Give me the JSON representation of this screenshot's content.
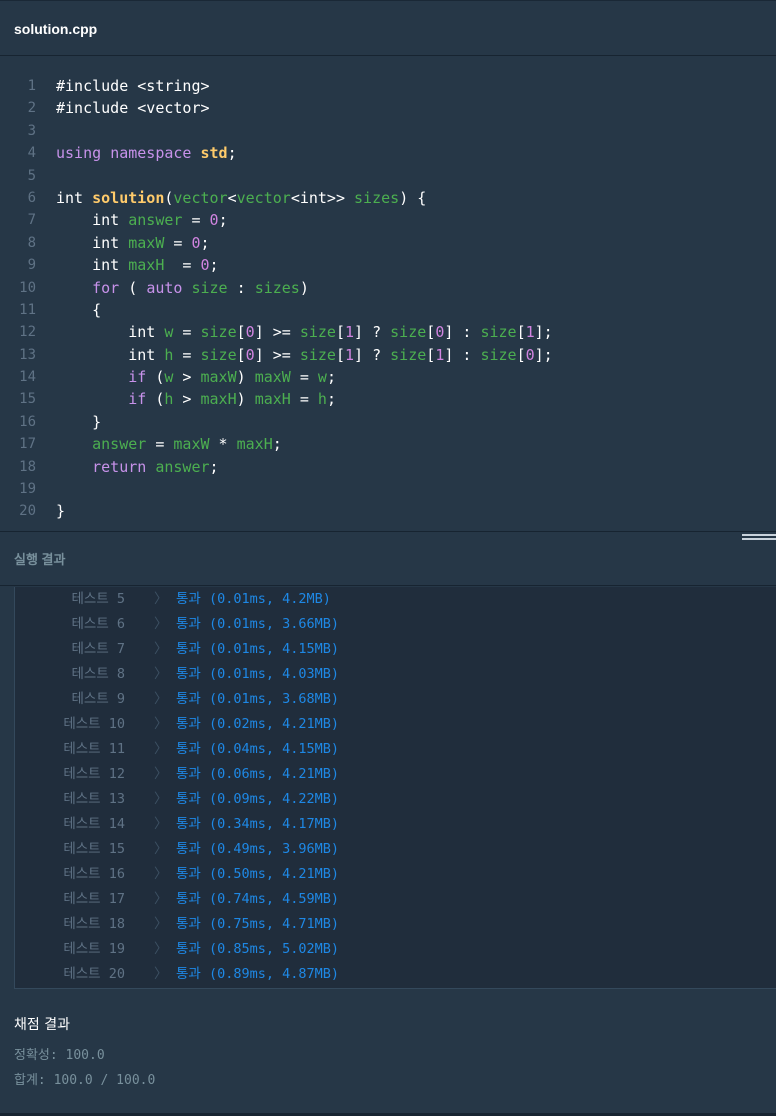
{
  "tab": {
    "title": "solution.cpp"
  },
  "editor": {
    "lines": [
      {
        "n": "1",
        "tokens": [
          [
            "plain",
            "#include <string>"
          ]
        ]
      },
      {
        "n": "2",
        "tokens": [
          [
            "plain",
            "#include <vector>"
          ]
        ]
      },
      {
        "n": "3",
        "tokens": []
      },
      {
        "n": "4",
        "tokens": [
          [
            "kw",
            "using "
          ],
          [
            "ns",
            "namespace "
          ],
          [
            "std",
            "std"
          ],
          [
            "plain",
            ";"
          ]
        ]
      },
      {
        "n": "5",
        "tokens": []
      },
      {
        "n": "6",
        "tokens": [
          [
            "ty",
            "int "
          ],
          [
            "fn",
            "solution"
          ],
          [
            "plain",
            "("
          ],
          [
            "id",
            "vector"
          ],
          [
            "plain",
            "<"
          ],
          [
            "id",
            "vector"
          ],
          [
            "plain",
            "<int>> "
          ],
          [
            "id",
            "sizes"
          ],
          [
            "plain",
            ") {"
          ]
        ]
      },
      {
        "n": "7",
        "tokens": [
          [
            "plain",
            "    int "
          ],
          [
            "id",
            "answer"
          ],
          [
            "plain",
            " = "
          ],
          [
            "num",
            "0"
          ],
          [
            "plain",
            ";"
          ]
        ]
      },
      {
        "n": "8",
        "tokens": [
          [
            "plain",
            "    int "
          ],
          [
            "id",
            "maxW"
          ],
          [
            "plain",
            " = "
          ],
          [
            "num",
            "0"
          ],
          [
            "plain",
            ";"
          ]
        ]
      },
      {
        "n": "9",
        "tokens": [
          [
            "plain",
            "    int "
          ],
          [
            "id",
            "maxH"
          ],
          [
            "plain",
            "  = "
          ],
          [
            "num",
            "0"
          ],
          [
            "plain",
            ";"
          ]
        ]
      },
      {
        "n": "10",
        "tokens": [
          [
            "plain",
            "    "
          ],
          [
            "kw",
            "for"
          ],
          [
            "plain",
            " ( "
          ],
          [
            "kw",
            "auto"
          ],
          [
            "plain",
            " "
          ],
          [
            "id",
            "size"
          ],
          [
            "plain",
            " : "
          ],
          [
            "id",
            "sizes"
          ],
          [
            "plain",
            ")"
          ]
        ]
      },
      {
        "n": "11",
        "tokens": [
          [
            "plain",
            "    {"
          ]
        ]
      },
      {
        "n": "12",
        "tokens": [
          [
            "plain",
            "        int "
          ],
          [
            "id",
            "w"
          ],
          [
            "plain",
            " = "
          ],
          [
            "id",
            "size"
          ],
          [
            "plain",
            "["
          ],
          [
            "num",
            "0"
          ],
          [
            "plain",
            "] >= "
          ],
          [
            "id",
            "size"
          ],
          [
            "plain",
            "["
          ],
          [
            "num",
            "1"
          ],
          [
            "plain",
            "] ? "
          ],
          [
            "id",
            "size"
          ],
          [
            "plain",
            "["
          ],
          [
            "num",
            "0"
          ],
          [
            "plain",
            "] : "
          ],
          [
            "id",
            "size"
          ],
          [
            "plain",
            "["
          ],
          [
            "num",
            "1"
          ],
          [
            "plain",
            "];"
          ]
        ]
      },
      {
        "n": "13",
        "tokens": [
          [
            "plain",
            "        int "
          ],
          [
            "id",
            "h"
          ],
          [
            "plain",
            " = "
          ],
          [
            "id",
            "size"
          ],
          [
            "plain",
            "["
          ],
          [
            "num",
            "0"
          ],
          [
            "plain",
            "] >= "
          ],
          [
            "id",
            "size"
          ],
          [
            "plain",
            "["
          ],
          [
            "num",
            "1"
          ],
          [
            "plain",
            "] ? "
          ],
          [
            "id",
            "size"
          ],
          [
            "plain",
            "["
          ],
          [
            "num",
            "1"
          ],
          [
            "plain",
            "] : "
          ],
          [
            "id",
            "size"
          ],
          [
            "plain",
            "["
          ],
          [
            "num",
            "0"
          ],
          [
            "plain",
            "];"
          ]
        ]
      },
      {
        "n": "14",
        "tokens": [
          [
            "plain",
            "        "
          ],
          [
            "kw",
            "if"
          ],
          [
            "plain",
            " ("
          ],
          [
            "id",
            "w"
          ],
          [
            "plain",
            " > "
          ],
          [
            "id",
            "maxW"
          ],
          [
            "plain",
            ") "
          ],
          [
            "id",
            "maxW"
          ],
          [
            "plain",
            " = "
          ],
          [
            "id",
            "w"
          ],
          [
            "plain",
            ";"
          ]
        ]
      },
      {
        "n": "15",
        "tokens": [
          [
            "plain",
            "        "
          ],
          [
            "kw",
            "if"
          ],
          [
            "plain",
            " ("
          ],
          [
            "id",
            "h"
          ],
          [
            "plain",
            " > "
          ],
          [
            "id",
            "maxH"
          ],
          [
            "plain",
            ") "
          ],
          [
            "id",
            "maxH"
          ],
          [
            "plain",
            " = "
          ],
          [
            "id",
            "h"
          ],
          [
            "plain",
            ";"
          ]
        ]
      },
      {
        "n": "16",
        "tokens": [
          [
            "plain",
            "    }"
          ]
        ]
      },
      {
        "n": "17",
        "tokens": [
          [
            "plain",
            "    "
          ],
          [
            "id",
            "answer"
          ],
          [
            "plain",
            " = "
          ],
          [
            "id",
            "maxW"
          ],
          [
            "plain",
            " * "
          ],
          [
            "id",
            "maxH"
          ],
          [
            "plain",
            ";"
          ]
        ]
      },
      {
        "n": "18",
        "tokens": [
          [
            "plain",
            "    "
          ],
          [
            "kw",
            "return"
          ],
          [
            "plain",
            " "
          ],
          [
            "id",
            "answer"
          ],
          [
            "plain",
            ";"
          ]
        ]
      },
      {
        "n": "19",
        "tokens": []
      },
      {
        "n": "20",
        "tokens": [
          [
            "plain",
            "}"
          ]
        ]
      }
    ]
  },
  "result": {
    "title": "실행 결과",
    "tests": [
      {
        "label": "테스트 5",
        "arrow": "〉",
        "result": "통과 (0.01ms, 4.2MB)"
      },
      {
        "label": "테스트 6",
        "arrow": "〉",
        "result": "통과 (0.01ms, 3.66MB)"
      },
      {
        "label": "테스트 7",
        "arrow": "〉",
        "result": "통과 (0.01ms, 4.15MB)"
      },
      {
        "label": "테스트 8",
        "arrow": "〉",
        "result": "통과 (0.01ms, 4.03MB)"
      },
      {
        "label": "테스트 9",
        "arrow": "〉",
        "result": "통과 (0.01ms, 3.68MB)"
      },
      {
        "label": "테스트 10",
        "arrow": "〉",
        "result": "통과 (0.02ms, 4.21MB)"
      },
      {
        "label": "테스트 11",
        "arrow": "〉",
        "result": "통과 (0.04ms, 4.15MB)"
      },
      {
        "label": "테스트 12",
        "arrow": "〉",
        "result": "통과 (0.06ms, 4.21MB)"
      },
      {
        "label": "테스트 13",
        "arrow": "〉",
        "result": "통과 (0.09ms, 4.22MB)"
      },
      {
        "label": "테스트 14",
        "arrow": "〉",
        "result": "통과 (0.34ms, 4.17MB)"
      },
      {
        "label": "테스트 15",
        "arrow": "〉",
        "result": "통과 (0.49ms, 3.96MB)"
      },
      {
        "label": "테스트 16",
        "arrow": "〉",
        "result": "통과 (0.50ms, 4.21MB)"
      },
      {
        "label": "테스트 17",
        "arrow": "〉",
        "result": "통과 (0.74ms, 4.59MB)"
      },
      {
        "label": "테스트 18",
        "arrow": "〉",
        "result": "통과 (0.75ms, 4.71MB)"
      },
      {
        "label": "테스트 19",
        "arrow": "〉",
        "result": "통과 (0.85ms, 5.02MB)"
      },
      {
        "label": "테스트 20",
        "arrow": "〉",
        "result": "통과 (0.89ms, 4.87MB)"
      }
    ]
  },
  "grading": {
    "title": "채점 결과",
    "accuracy": "정확성: 100.0",
    "total": "합계: 100.0 / 100.0"
  }
}
